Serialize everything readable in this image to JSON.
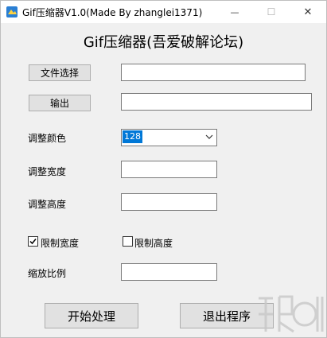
{
  "window": {
    "title": "Gif压缩器V1.0(Made By zhanglei1371)",
    "controls": {
      "minimize": "—",
      "maximize": "☐",
      "close": "✕"
    }
  },
  "heading": "Gif压缩器(吾爱破解论坛)",
  "file_select": {
    "label": "文件选择",
    "value": ""
  },
  "output": {
    "label": "输出",
    "value": ""
  },
  "color": {
    "label": "调整颜色",
    "selected": "128"
  },
  "width": {
    "label": "调整宽度",
    "value": ""
  },
  "height": {
    "label": "调整高度",
    "value": ""
  },
  "limit_width": {
    "label": "限制宽度",
    "checked": true
  },
  "limit_height": {
    "label": "限制高度",
    "checked": false
  },
  "scale": {
    "label": "缩放比例",
    "value": ""
  },
  "actions": {
    "start": "开始处理",
    "exit": "退出程序"
  },
  "colors": {
    "accent": "#0078d7",
    "button_bg": "#e1e1e1",
    "window_bg": "#f0f0f0"
  }
}
